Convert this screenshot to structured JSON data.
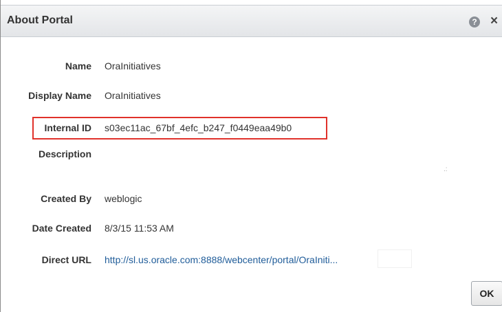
{
  "dialog": {
    "title": "About Portal",
    "help_icon": "help-icon",
    "help_glyph": "?",
    "close_icon": "close-icon",
    "close_glyph": "×"
  },
  "fields": {
    "name": {
      "label": "Name",
      "value": "OraInitiatives"
    },
    "display_name": {
      "label": "Display Name",
      "value": "OraInitiatives"
    },
    "internal_id": {
      "label": "Internal ID",
      "value": "s03ec11ac_67bf_4efc_b247_f0449eaa49b0"
    },
    "description": {
      "label": "Description",
      "value": ""
    },
    "created_by": {
      "label": "Created By",
      "value": "weblogic"
    },
    "date_created": {
      "label": "Date Created",
      "value": "8/3/15 11:53 AM"
    },
    "direct_url": {
      "label": "Direct URL",
      "value": "http://sl.us.oracle.com:8888/webcenter/portal/OraIniti..."
    }
  },
  "buttons": {
    "ok_label": "OK"
  },
  "colors": {
    "highlight": "#e0312a",
    "link": "#1f5c99",
    "title_bar": "#e3e5e8"
  }
}
